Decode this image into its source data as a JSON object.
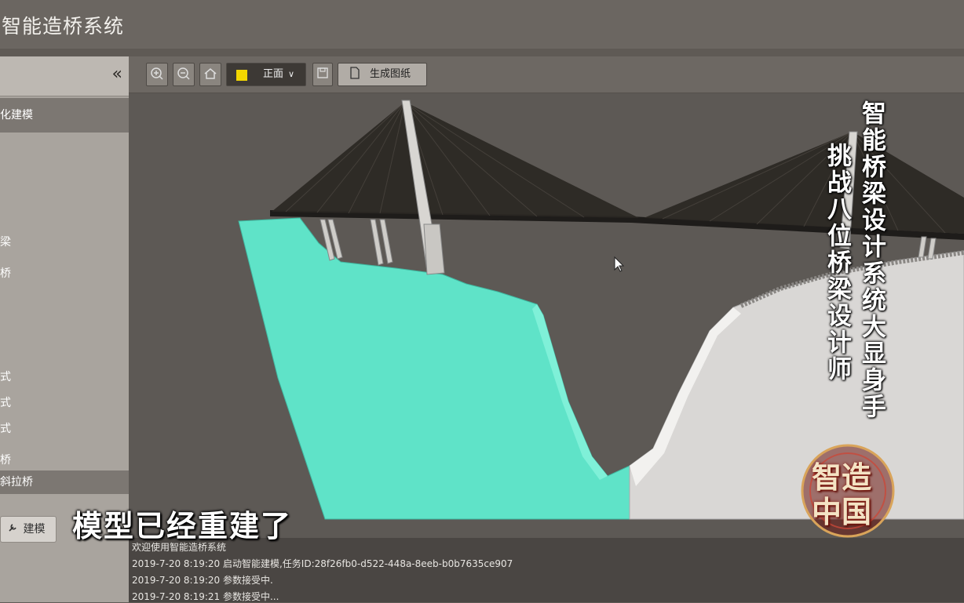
{
  "app": {
    "title": "智能造桥系统"
  },
  "sidebar": {
    "collapse_glyph": "«",
    "section_header": "化建模",
    "items": [
      "梁",
      "桥",
      "式",
      "式",
      "式",
      "桥"
    ],
    "section_footer": "斜拉桥",
    "build_label": "建模"
  },
  "toolbar": {
    "zoom_in_icon": "zoom-in-icon",
    "zoom_out_icon": "zoom-out-icon",
    "home_icon": "home-icon",
    "color_swatch": "#f2d600",
    "view_select": "正面",
    "save_icon": "save-icon",
    "generate_label": "生成图纸"
  },
  "overlays": {
    "subtitle": "模型已经重建了",
    "caption_right": "智能桥梁设计系统大显身手",
    "caption_left": "挑战八位桥梁设计师",
    "logo_line1": "智造",
    "logo_line2": "中国"
  },
  "log": {
    "lines": [
      "欢迎使用智能造桥系统",
      "2019-7-20 8:19:20 启动智能建模,任务ID:28f26fb0-d522-448a-8eeb-b0b7635ce907",
      "2019-7-20 8:19:20 参数接受中.",
      "2019-7-20 8:19:21 参数接受中..."
    ]
  },
  "colors": {
    "terrain_left": "#5fe3c8",
    "terrain_right": "#d9d7d5",
    "background": "#5d5955"
  }
}
